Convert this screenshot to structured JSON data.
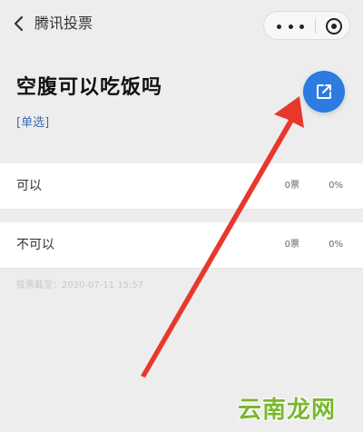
{
  "nav": {
    "title": "腾讯投票",
    "back_icon": "chevron-left-icon",
    "more_icon": "more-dots-icon",
    "close_icon": "target-close-icon"
  },
  "question": {
    "title": "空腹可以吃饭吗",
    "type_label": "[单选]",
    "edit_icon": "edit-share-icon"
  },
  "options": [
    {
      "label": "可以",
      "votes": "0票",
      "percent": "0%"
    },
    {
      "label": "不可以",
      "votes": "0票",
      "percent": "0%"
    }
  ],
  "deadline": "投票截至：2020-07-11 15:57",
  "annotation": {
    "arrow_color": "#e8382c"
  },
  "watermark": "云南龙网",
  "colors": {
    "accent": "#2d7ae0",
    "type_label": "#3d6bb8",
    "watermark": "#7ab72f"
  }
}
